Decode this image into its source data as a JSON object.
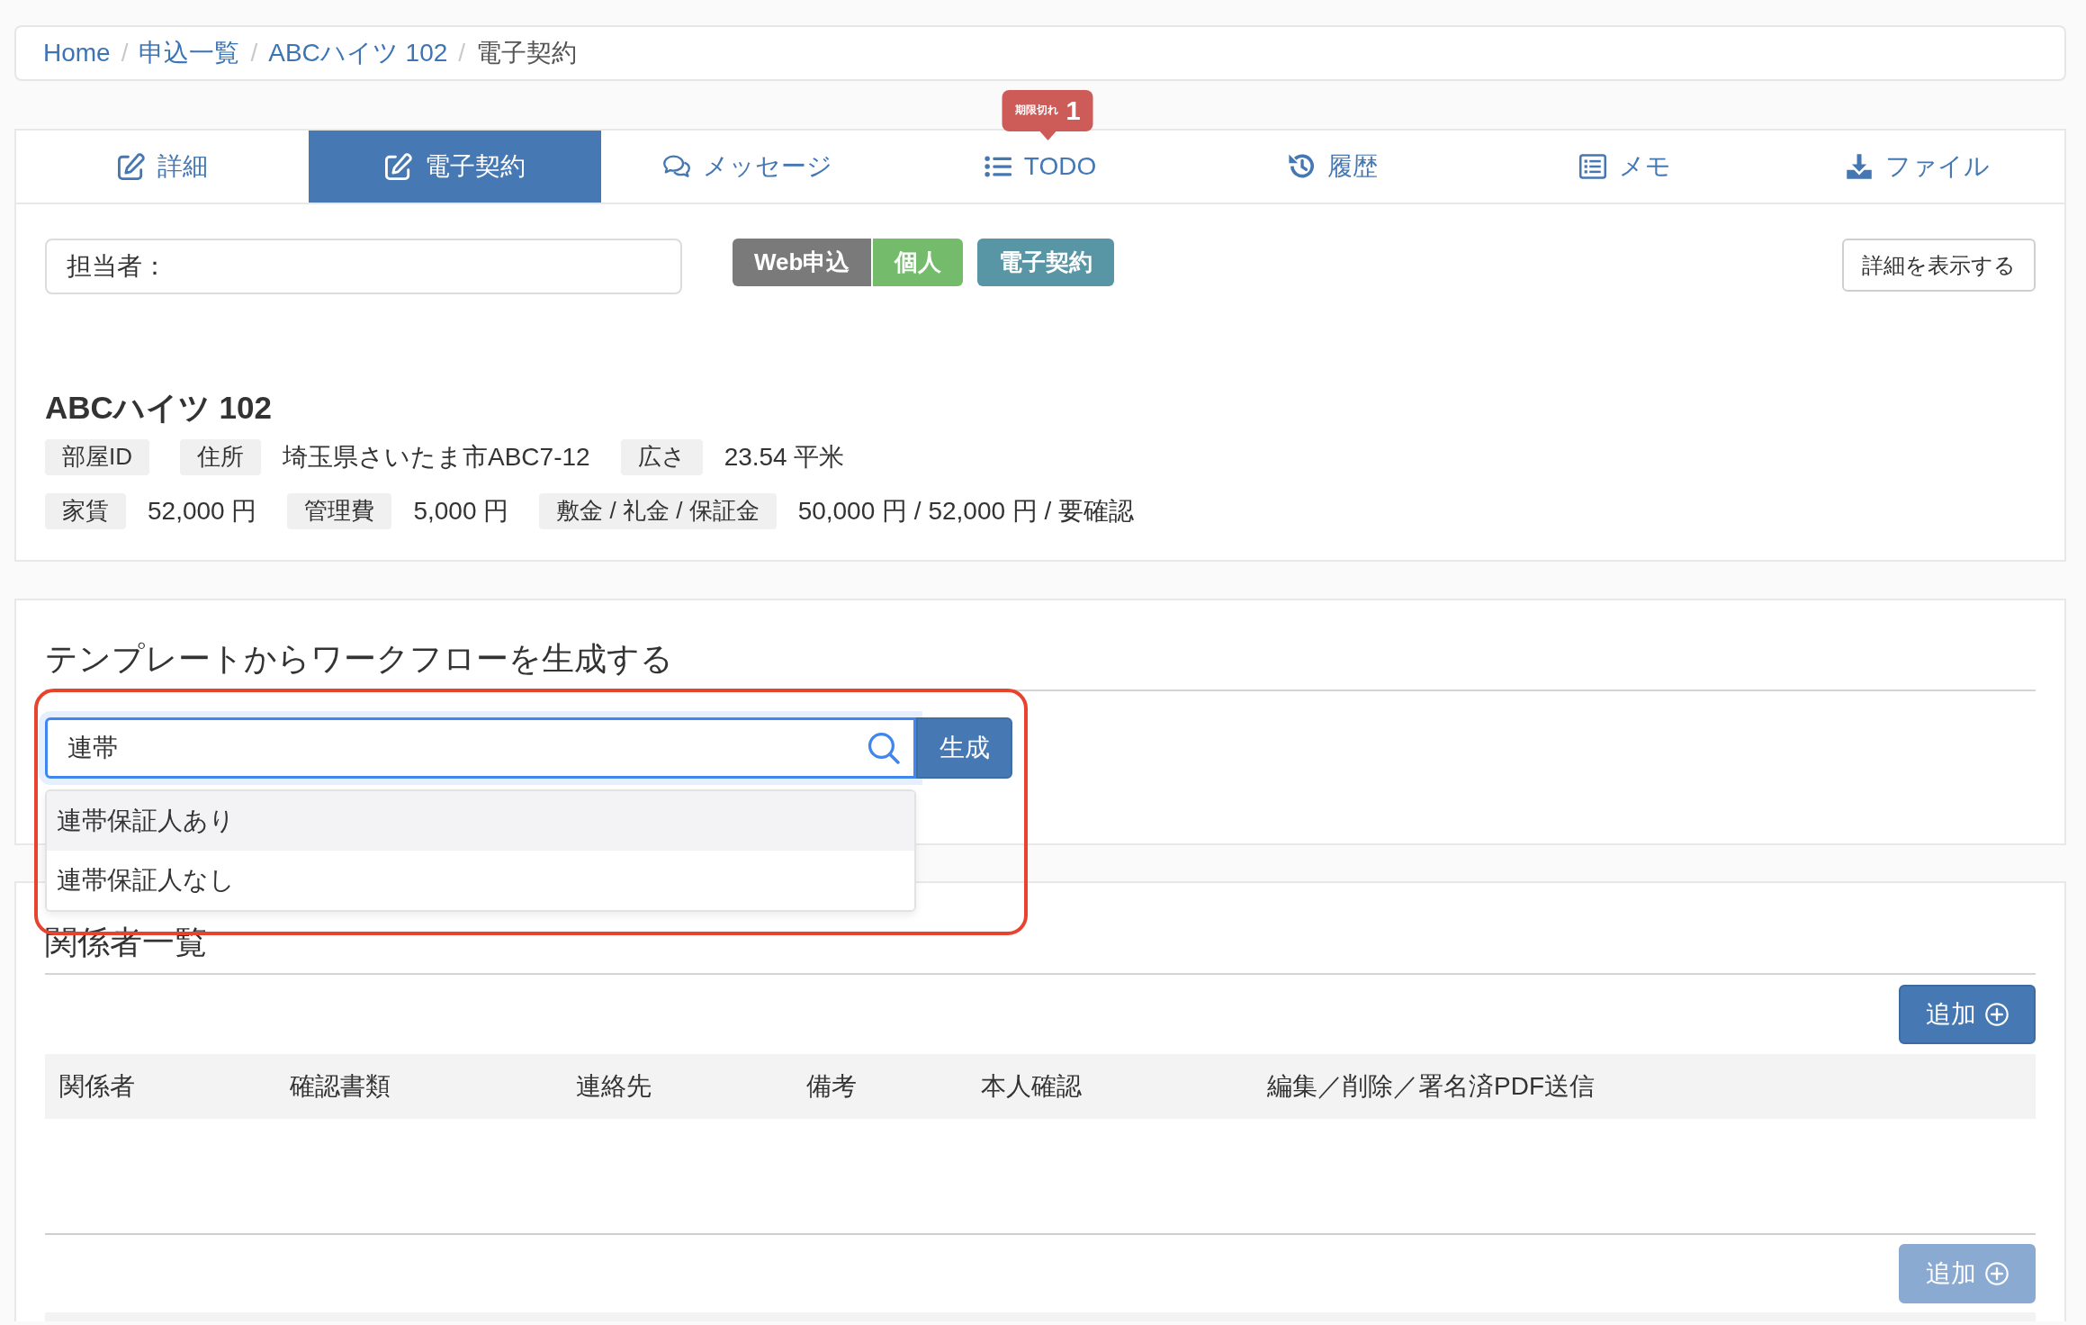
{
  "breadcrumb": {
    "separator": "/",
    "items": [
      {
        "label": "Home",
        "current": false
      },
      {
        "label": "申込一覧",
        "current": false
      },
      {
        "label": "ABCハイツ 102",
        "current": false
      },
      {
        "label": "電子契約",
        "current": true
      }
    ]
  },
  "tabs": [
    {
      "kind": "edit",
      "label": "詳細",
      "selected": false
    },
    {
      "kind": "edit",
      "label": "電子契約",
      "selected": true
    },
    {
      "kind": "chat",
      "label": "メッセージ",
      "selected": false
    },
    {
      "kind": "list",
      "label": "TODO",
      "selected": false,
      "badge": {
        "label": "期限切れ",
        "count": "1"
      }
    },
    {
      "kind": "history",
      "label": "履歴",
      "selected": false
    },
    {
      "kind": "memo",
      "label": "メモ",
      "selected": false
    },
    {
      "kind": "download",
      "label": "ファイル",
      "selected": false
    }
  ],
  "assignee_field": {
    "value": "担当者："
  },
  "tag_groups": [
    [
      {
        "label": "Web申込",
        "color": "#7a7a7a"
      },
      {
        "label": "個人",
        "color": "#74bb6b"
      }
    ],
    [
      {
        "label": "電子契約",
        "color": "#5896a6"
      }
    ]
  ],
  "detail_button": {
    "label": "詳細を表示する"
  },
  "property": {
    "title": "ABCハイツ 102",
    "rows": [
      [
        {
          "label": "部屋ID"
        },
        {
          "label": "住所",
          "value": "埼玉県さいたま市ABC7-12"
        },
        {
          "label": "広さ",
          "value": "23.54 平米"
        }
      ],
      [
        {
          "label": "家賃",
          "value": "52,000 円"
        },
        {
          "label": "管理費",
          "value": "5,000 円"
        },
        {
          "label": "敷金 / 礼金 / 保証金",
          "value": "50,000 円 / 52,000 円 / 要確認"
        }
      ]
    ]
  },
  "workflow": {
    "title": "テンプレートからワークフローを生成する",
    "search": {
      "value": "連帯"
    },
    "button": {
      "label": "生成"
    },
    "highlighted": true,
    "suggestions": [
      {
        "label": "連帯保証人あり",
        "selected": true
      },
      {
        "label": "連帯保証人なし",
        "selected": false
      }
    ]
  },
  "parties": {
    "title": "関係者一覧",
    "add_button": {
      "label": "追加",
      "disabled": false
    },
    "table": {
      "columns": [
        "関係者",
        "確認書類",
        "連絡先",
        "備考",
        "本人確認",
        "編集／削除／署名済PDF送信"
      ]
    },
    "footer_add_button": {
      "label": "追加",
      "disabled": true
    }
  }
}
